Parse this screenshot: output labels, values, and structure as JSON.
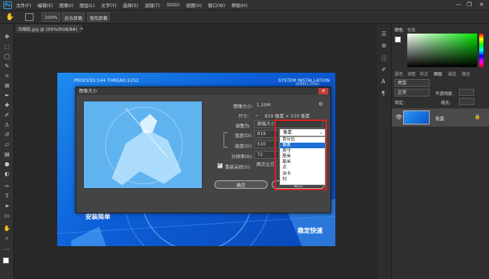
{
  "menubar": {
    "logo": "Ps",
    "items": [
      "文件(F)",
      "编辑(E)",
      "图像(I)",
      "图层(L)",
      "文字(Y)",
      "选择(S)",
      "滤镜(T)",
      "3D(D)",
      "视图(V)",
      "窗口(W)",
      "帮助(H)"
    ],
    "minimize": "—",
    "restore": "❐",
    "close": "✕"
  },
  "options_bar": {
    "zoom_value": "100%",
    "fit_screen": "适合屏幕",
    "fill_screen": "填充屏幕"
  },
  "document_tab": {
    "title": "压缩前.jpg @ 100%(RGB/8#)",
    "close": "×"
  },
  "toolbar": {
    "tools": [
      "move-icon",
      "marquee-icon",
      "lasso-icon",
      "quick-select-icon",
      "crop-icon",
      "frame-icon",
      "eyedropper-icon",
      "healing-icon",
      "brush-icon",
      "stamp-icon",
      "history-brush-icon",
      "eraser-icon",
      "gradient-icon",
      "blur-icon",
      "dodge-icon",
      "pen-icon",
      "type-icon",
      "path-select-icon",
      "rectangle-icon",
      "hand-icon",
      "zoom-icon",
      "more-icon"
    ]
  },
  "canvas_image": {
    "top_left_text": "PROCESS:144  THREAD:2252",
    "top_right_text": "SYSTEM INSTALLATION",
    "top_right_sub": "SPEED:2590",
    "bottom_left_text": "安装简单",
    "bottom_right_text": "稳定快速"
  },
  "dialog": {
    "title": "图像大小",
    "close": "✕",
    "image_size_label": "图像大小:",
    "image_size_value": "1.20M",
    "dimensions_label": "尺寸:",
    "dimensions_value": "819 像素 × 510 像素",
    "fit_to_label": "调整为:",
    "fit_to_value": "原稿大小",
    "width_label": "宽度(D):",
    "width_value": "819",
    "height_label": "高度(G):",
    "height_value": "510",
    "resolution_label": "分辨率(R):",
    "resolution_value": "72",
    "resample_label": "重新采样(S):",
    "resample_value": "两次立方",
    "ok_label": "确定",
    "cancel_label": "取消",
    "gear": "⚙"
  },
  "unit_dropdown": {
    "selected": "像素",
    "options": [
      "百分比",
      "像素",
      "英寸",
      "厘米",
      "毫米",
      "点",
      "派卡",
      "列"
    ],
    "highlighted_index": 1
  },
  "right_panel": {
    "color_tabs": [
      "颜色",
      "色板"
    ],
    "layer_tabs": [
      "属性",
      "调整",
      "样式",
      "图层",
      "通道",
      "路径"
    ],
    "kind_filter": "类型",
    "blend_mode": "正常",
    "opacity_label": "不透明度:",
    "lock_label": "锁定:",
    "fill_label": "填充:",
    "layer_name": "背景"
  },
  "colors": {
    "accent": "#31a8ff",
    "highlight_red": "#e51e1e",
    "dropdown_selected": "#1e6fd8",
    "image_blue": "#0c5ed6"
  }
}
